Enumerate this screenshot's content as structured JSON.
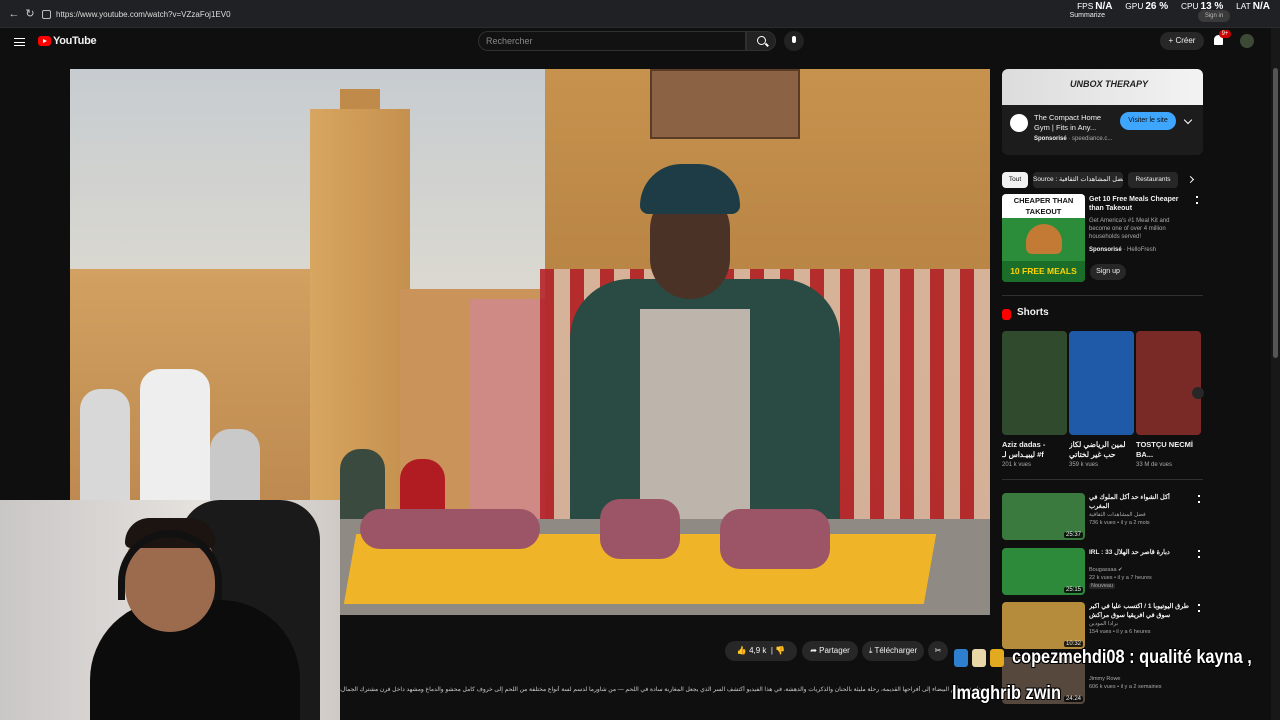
{
  "browser": {
    "url": "https://www.youtube.com/watch?v=VZzaFoj1EV0",
    "summarize": "Summarize",
    "sign_in": "Sign in"
  },
  "overlay_stats": {
    "fps_label": "FPS",
    "fps_value": "N/A",
    "gpu_label": "GPU",
    "gpu_value": "26 %",
    "cpu_label": "CPU",
    "cpu_value": "13 %",
    "lat_label": "LAT",
    "lat_value": "N/A"
  },
  "header": {
    "logo_text": "YouTube",
    "search_placeholder": "Rechercher",
    "create_label": "Créer",
    "notifications_badge": "9+"
  },
  "actions": {
    "likes": "4,9 k",
    "share": "Partager",
    "download": "Télécharger"
  },
  "description_snippet": "...رحلة في عالم البيضاء إلى أفراحها القديمة، رحلة مليئة بالحنان والذكريات والدهشة. في هذا الفيديو أكتشف السر الذي يجعل المغاربة سادة في اللحم — من شاورما لدسم لسة أنواع مختلفة من اللحم إلى خروف كامل محشو والدماغ ومشهد داخل فرن مشترك الجمال، النفس يحكي ما",
  "sidebar": {
    "ad": {
      "banner": "UNBOX THERAPY",
      "title": "The Compact Home Gym | Fits in Any...",
      "sponsored": "Sponsorisé",
      "domain": "speediance.c...",
      "cta": "Visiter le site"
    },
    "chips": [
      "Tout",
      "Source : فضل المشاهدات الثقافية",
      "Restaurants"
    ],
    "ad2": {
      "thumb_top": "CHEAPER THAN TAKEOUT",
      "thumb_bottom": "10 FREE MEALS",
      "title": "Get 10 Free Meals Cheaper than Takeout",
      "desc": "Get America's #1 Meal Kit and become one of over 4 million households served!",
      "sponsored": "Sponsorisé",
      "advertiser": "HelloFresh",
      "cta": "Sign up"
    },
    "shorts_title": "Shorts",
    "shorts": [
      {
        "title": "Aziz dadas - ليبيـداس لـ #f",
        "views": "201 k vues",
        "color": "#2f4a2c"
      },
      {
        "title": "لمين الرياضي لكاز حب غير لختاتي",
        "views": "359 k vues",
        "color": "#1f5aa8"
      },
      {
        "title": "TOSTÇU NECMİ BA...",
        "views": "33 M de vues",
        "color": "#7a2a26"
      }
    ],
    "videos": [
      {
        "title": "أكل الشواء حد أكل الملوك في المغرب",
        "channel": "فضل المشاهدات الثقافية",
        "meta": "736 k vues • il y a 2 mois",
        "duration": "25:37",
        "badge": "",
        "color": "#3a7a3e"
      },
      {
        "title": "IRL : 33 دبارة قاصر حد الهلال",
        "channel": "Bougassaa ✔",
        "meta": "22 k vues • il y a 7 heures",
        "duration": "25:15",
        "badge": "Nouveau",
        "color": "#2c8a3a"
      },
      {
        "title": "طرق اليوتيوبا 1 / اكتسب عليا في اكبر سوق في افريقيا سوق مراكش",
        "channel": "برادا المودين",
        "meta": "154 vues • il y a 6 heures",
        "duration": "10:32",
        "badge": "",
        "color": "#b58b3c"
      },
      {
        "title": "Hood...",
        "channel": "Jimmy Rowe",
        "meta": "606 k vues • il y a 2 semaines",
        "duration": "24:24",
        "badge": "",
        "color": "#56483c"
      }
    ]
  },
  "chat": {
    "username": "copezmehdi08",
    "message_part1": ": qualité kayna ,",
    "message_part2": "lmaghrib zwin"
  }
}
